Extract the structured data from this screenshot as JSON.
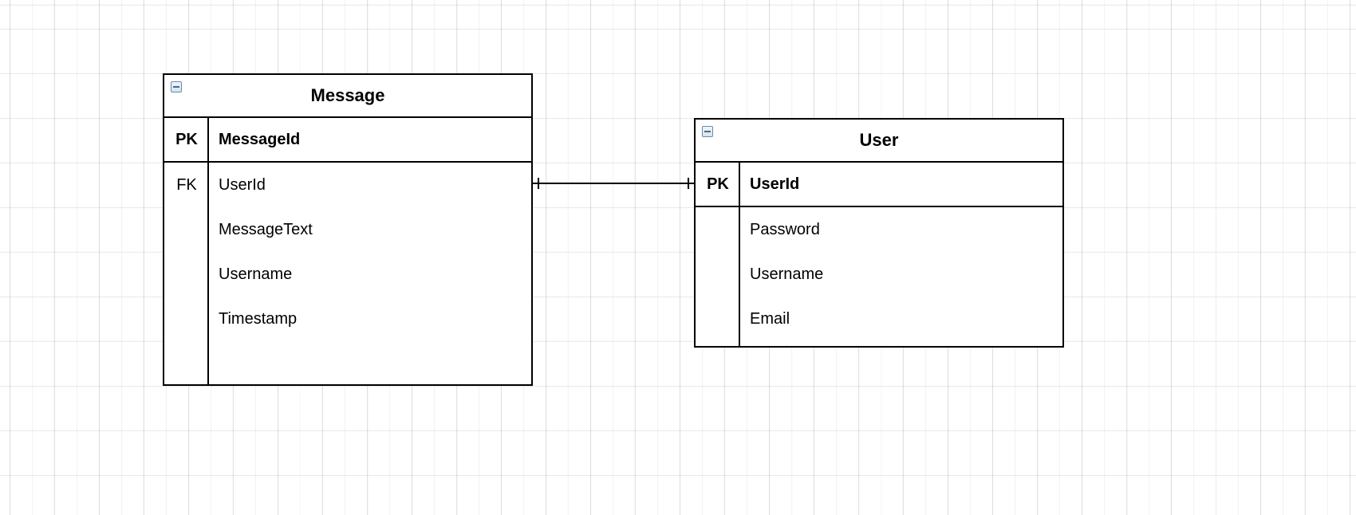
{
  "entities": {
    "message": {
      "title": "Message",
      "pk_label": "PK",
      "pk_field": "MessageId",
      "rows": [
        {
          "key": "FK",
          "field": "UserId"
        },
        {
          "key": "",
          "field": "MessageText"
        },
        {
          "key": "",
          "field": "Username"
        },
        {
          "key": "",
          "field": "Timestamp"
        }
      ]
    },
    "user": {
      "title": "User",
      "pk_label": "PK",
      "pk_field": "UserId",
      "rows": [
        {
          "key": "",
          "field": "Password"
        },
        {
          "key": "",
          "field": "Username"
        },
        {
          "key": "",
          "field": "Email"
        }
      ]
    }
  },
  "relationship": {
    "from": "Message.UserId",
    "to": "User.UserId",
    "type": "one-to-one"
  }
}
